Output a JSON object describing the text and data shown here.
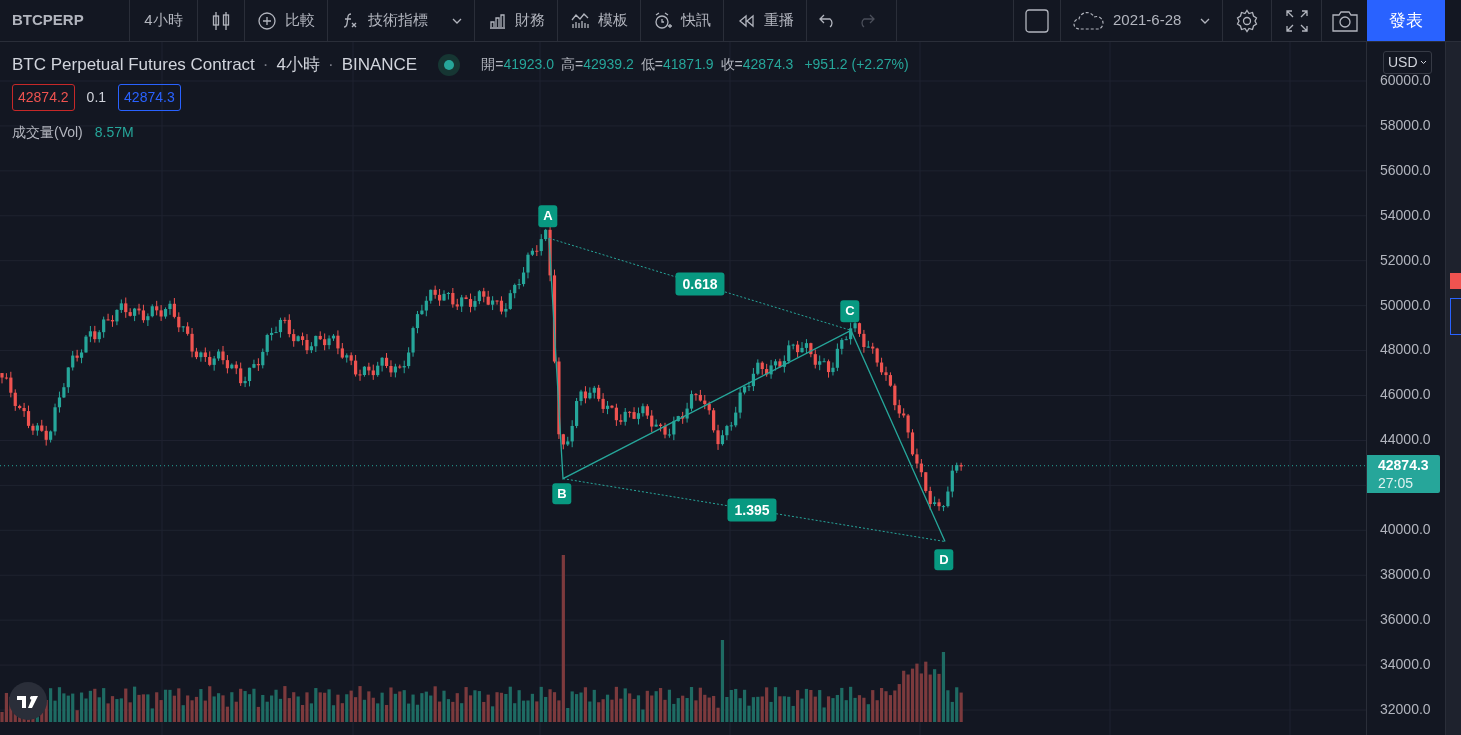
{
  "toolbar": {
    "symbol": "BTCPERP",
    "interval": "4小時",
    "items": [
      {
        "label": "比較",
        "dropdown": false
      },
      {
        "label": "技術指標",
        "dropdown": true
      },
      {
        "label": "財務",
        "dropdown": false
      },
      {
        "label": "模板",
        "dropdown": false
      },
      {
        "label": "快訊",
        "dropdown": false
      },
      {
        "label": "重播",
        "dropdown": false
      }
    ],
    "undo_disabled": false,
    "redo_disabled": true,
    "date": "2021-6-28",
    "publish": "發表"
  },
  "legend": {
    "title": "BTC Perpetual Futures Contract",
    "interval": "4小時",
    "exchange": "BINANCE",
    "separator": "·",
    "ohlc": [
      {
        "label": "開=",
        "value": "41923.0"
      },
      {
        "label": "高=",
        "value": "42939.2"
      },
      {
        "label": "低=",
        "value": "41871.9"
      },
      {
        "label": "收=",
        "value": "42874.3"
      }
    ],
    "change": "+951.2 (+2.27%)",
    "sell": "42874.2",
    "spread": "0.1",
    "buy": "42874.3"
  },
  "volume": {
    "label": "成交量(Vol)",
    "value": "8.57M"
  },
  "pattern": {
    "points": [
      "A",
      "B",
      "C",
      "D"
    ],
    "ratios": [
      "0.618",
      "1.395"
    ]
  },
  "price_axis": {
    "currency": "USD",
    "ticks_above": [
      "60000.0",
      "58000.0",
      "56000.0",
      "54000.0",
      "52000.0",
      "50000.0",
      "48000.0",
      "46000.0",
      "44000.0"
    ],
    "ticks_below": [
      "40000.0",
      "38000.0",
      "36000.0",
      "34000.0",
      "32000.0"
    ],
    "last_price": "42874.3",
    "countdown": "27:05"
  }
}
